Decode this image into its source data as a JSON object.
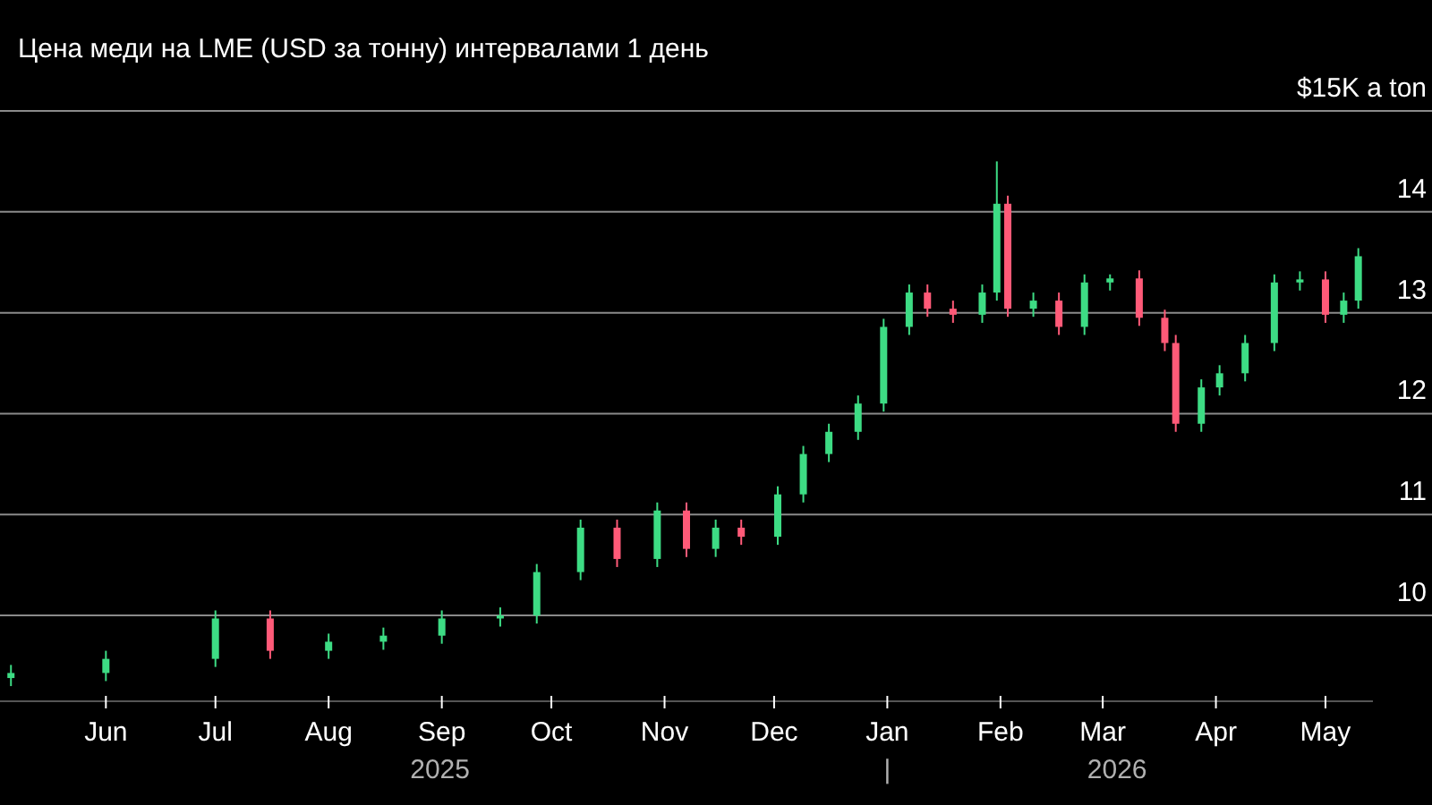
{
  "chart_data": {
    "type": "candlestick",
    "title": "Цена меди на LME (USD за тонну) интервалами 1 день",
    "grid": true,
    "xlim": [
      "2025-05-03",
      "2026-05-14"
    ],
    "ylim": [
      9.15,
      15
    ],
    "x": [
      "2025-05-06",
      "2025-06-01",
      "2025-07-01",
      "2025-07-16",
      "2025-08-01",
      "2025-08-16",
      "2025-09-01",
      "2025-09-17",
      "2025-09-27",
      "2025-10-09",
      "2025-10-19",
      "2025-10-30",
      "2025-11-07",
      "2025-11-15",
      "2025-11-22",
      "2025-12-02",
      "2025-12-09",
      "2025-12-16",
      "2025-12-24",
      "2025-12-31",
      "2026-01-07",
      "2026-01-12",
      "2026-01-19",
      "2026-01-27",
      "2026-01-31",
      "2026-02-03",
      "2026-02-10",
      "2026-02-17",
      "2026-02-24",
      "2026-03-03",
      "2026-03-11",
      "2026-03-18",
      "2026-03-21",
      "2026-03-28",
      "2026-04-02",
      "2026-04-09",
      "2026-04-17",
      "2026-04-24",
      "2026-05-01",
      "2026-05-06",
      "2026-05-10"
    ],
    "ohlc": [
      [
        9.38,
        9.51,
        9.3,
        9.43
      ],
      [
        9.43,
        9.65,
        9.35,
        9.57
      ],
      [
        9.57,
        10.05,
        9.49,
        9.97
      ],
      [
        9.97,
        10.05,
        9.57,
        9.65
      ],
      [
        9.65,
        9.82,
        9.57,
        9.74
      ],
      [
        9.74,
        9.88,
        9.66,
        9.8
      ],
      [
        9.8,
        10.05,
        9.72,
        9.97
      ],
      [
        9.97,
        10.08,
        9.89,
        10.0
      ],
      [
        10.0,
        10.51,
        9.92,
        10.43
      ],
      [
        10.43,
        10.95,
        10.35,
        10.87
      ],
      [
        10.87,
        10.95,
        10.48,
        10.56
      ],
      [
        10.56,
        11.12,
        10.48,
        11.04
      ],
      [
        11.04,
        11.12,
        10.58,
        10.66
      ],
      [
        10.66,
        10.95,
        10.58,
        10.87
      ],
      [
        10.87,
        10.95,
        10.7,
        10.78
      ],
      [
        10.78,
        11.28,
        10.7,
        11.2
      ],
      [
        11.2,
        11.68,
        11.12,
        11.6
      ],
      [
        11.6,
        11.9,
        11.52,
        11.82
      ],
      [
        11.82,
        12.18,
        11.74,
        12.1
      ],
      [
        12.1,
        12.94,
        12.02,
        12.86
      ],
      [
        12.86,
        13.28,
        12.78,
        13.2
      ],
      [
        13.2,
        13.28,
        12.96,
        13.04
      ],
      [
        13.04,
        13.12,
        12.9,
        12.98
      ],
      [
        12.98,
        13.28,
        12.9,
        13.2
      ],
      [
        13.2,
        14.5,
        13.12,
        14.08
      ],
      [
        14.08,
        14.16,
        12.96,
        13.04
      ],
      [
        13.04,
        13.2,
        12.96,
        13.12
      ],
      [
        13.12,
        13.2,
        12.78,
        12.86
      ],
      [
        12.86,
        13.38,
        12.78,
        13.3
      ],
      [
        13.3,
        13.38,
        13.22,
        13.34
      ],
      [
        13.34,
        13.42,
        12.87,
        12.95
      ],
      [
        12.95,
        13.03,
        12.62,
        12.7
      ],
      [
        12.7,
        12.78,
        11.82,
        11.9
      ],
      [
        11.9,
        12.34,
        11.82,
        12.26
      ],
      [
        12.26,
        12.48,
        12.18,
        12.4
      ],
      [
        12.4,
        12.78,
        12.32,
        12.7
      ],
      [
        12.7,
        13.38,
        12.62,
        13.3
      ],
      [
        13.3,
        13.41,
        13.22,
        13.33
      ],
      [
        13.33,
        13.41,
        12.9,
        12.98
      ],
      [
        12.98,
        13.2,
        12.9,
        13.12
      ],
      [
        13.12,
        13.64,
        13.04,
        13.56
      ]
    ],
    "xticks": [
      {
        "value": "2025-06-01",
        "label": "Jun"
      },
      {
        "value": "2025-07-01",
        "label": "Jul"
      },
      {
        "value": "2025-08-01",
        "label": "Aug"
      },
      {
        "value": "2025-09-01",
        "label": "Sep"
      },
      {
        "value": "2025-10-01",
        "label": "Oct"
      },
      {
        "value": "2025-11-01",
        "label": "Nov"
      },
      {
        "value": "2025-12-01",
        "label": "Dec"
      },
      {
        "value": "2026-01-01",
        "label": "Jan"
      },
      {
        "value": "2026-02-01",
        "label": "Feb"
      },
      {
        "value": "2026-03-01",
        "label": "Mar"
      },
      {
        "value": "2026-04-01",
        "label": "Apr"
      },
      {
        "value": "2026-05-01",
        "label": "May"
      }
    ],
    "yticks": [
      {
        "value": 10,
        "label": "10"
      },
      {
        "value": 11,
        "label": "11"
      },
      {
        "value": 12,
        "label": "12"
      },
      {
        "value": 13,
        "label": "13"
      },
      {
        "value": 14,
        "label": "14"
      },
      {
        "value": 15,
        "label": "$15K a ton"
      }
    ]
  },
  "year_labels": [
    "2025",
    "|",
    "2026"
  ]
}
